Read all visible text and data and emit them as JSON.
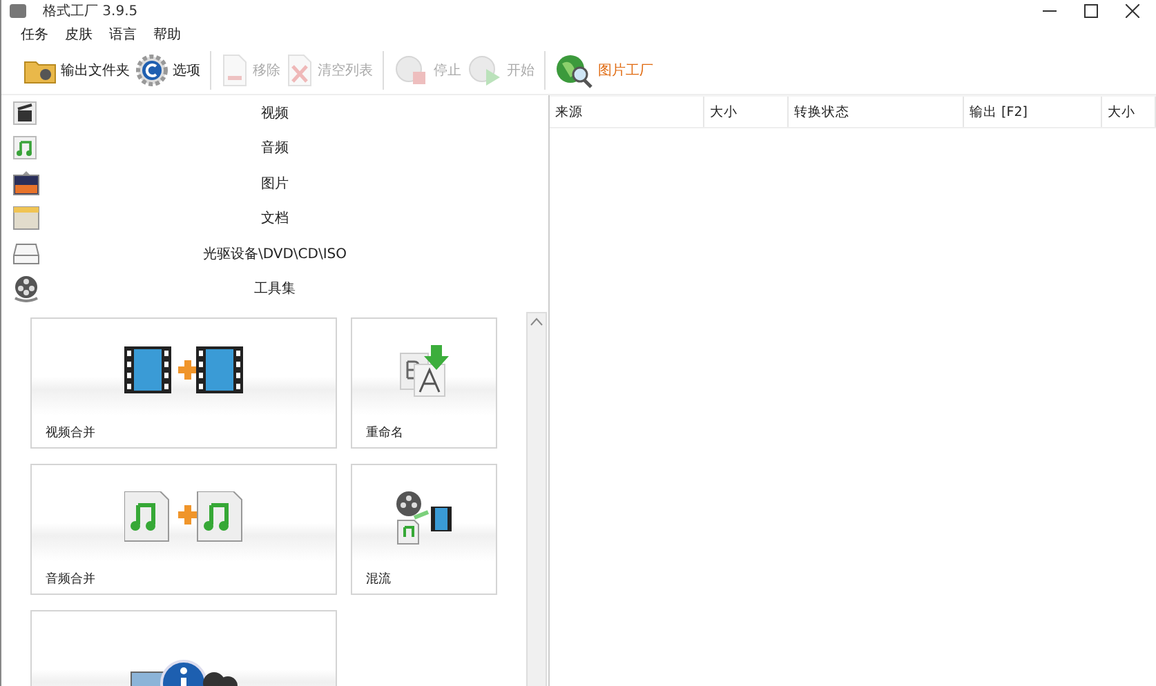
{
  "window": {
    "title": "格式工厂 3.9.5"
  },
  "menu": [
    "任务",
    "皮肤",
    "语言",
    "帮助"
  ],
  "toolbar": [
    {
      "label": "输出文件夹",
      "kind": "folder",
      "disabled": false
    },
    {
      "label": "选项",
      "kind": "gear",
      "disabled": false
    },
    {
      "label": "移除",
      "kind": "remove",
      "disabled": true
    },
    {
      "label": "清空列表",
      "kind": "clear",
      "disabled": true
    },
    {
      "label": "停止",
      "kind": "stop",
      "disabled": true
    },
    {
      "label": "开始",
      "kind": "start",
      "disabled": true
    },
    {
      "label": "图片工厂",
      "kind": "globe",
      "disabled": false
    }
  ],
  "categories": [
    {
      "label": "视频",
      "kind": "video"
    },
    {
      "label": "音频",
      "kind": "audio"
    },
    {
      "label": "图片",
      "kind": "picture"
    },
    {
      "label": "文档",
      "kind": "document"
    },
    {
      "label": "光驱设备\\DVD\\CD\\ISO",
      "kind": "disc"
    },
    {
      "label": "工具集",
      "kind": "tools"
    }
  ],
  "tiles": [
    {
      "label": "视频合并",
      "kind": "video-join",
      "wide": true
    },
    {
      "label": "重命名",
      "kind": "rename",
      "wide": false
    },
    {
      "label": "音频合并",
      "kind": "audio-join",
      "wide": true
    },
    {
      "label": "混流",
      "kind": "mux",
      "wide": false
    },
    {
      "kind": "info",
      "wide": true
    }
  ],
  "table": {
    "columns": [
      "来源",
      "大小",
      "转换状态",
      "输出 [F2]",
      "大小"
    ]
  }
}
